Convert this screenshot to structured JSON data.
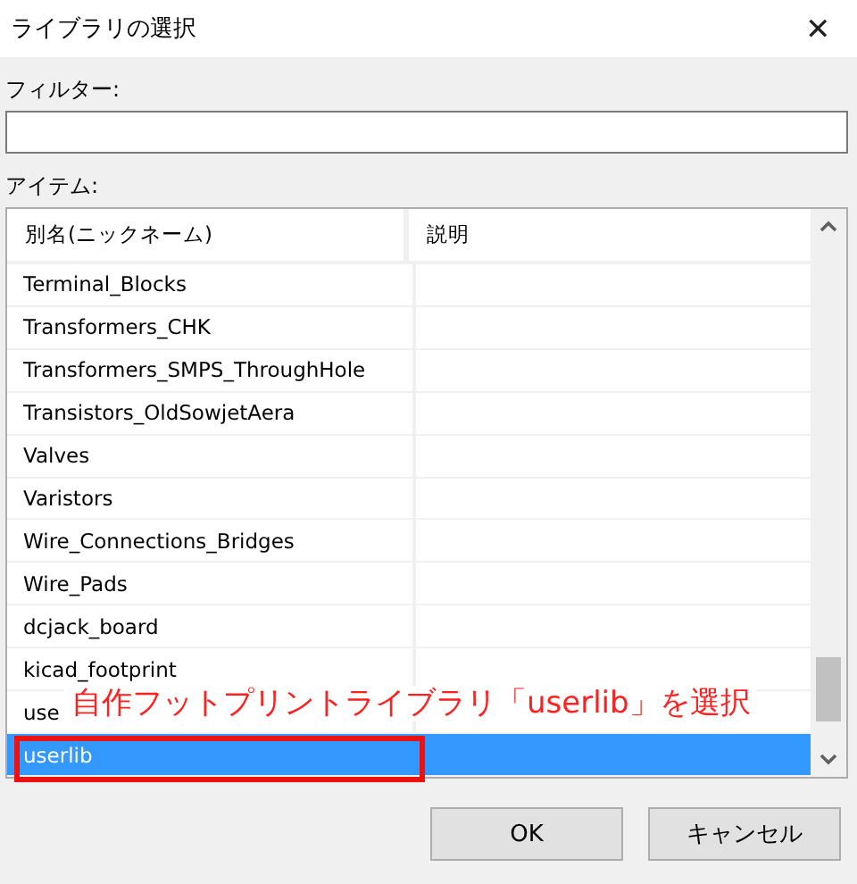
{
  "window": {
    "title": "ライブラリの選択",
    "close": "✕"
  },
  "filter": {
    "label": "フィルター:"
  },
  "items": {
    "label": "アイテム:",
    "columns": [
      "別名(ニックネーム)",
      "説明"
    ],
    "rows": [
      {
        "name": "Terminal_Blocks",
        "selected": false
      },
      {
        "name": "Transformers_CHK",
        "selected": false
      },
      {
        "name": "Transformers_SMPS_ThroughHole",
        "selected": false
      },
      {
        "name": "Transistors_OldSowjetAera",
        "selected": false
      },
      {
        "name": "Valves",
        "selected": false
      },
      {
        "name": "Varistors",
        "selected": false
      },
      {
        "name": "Wire_Connections_Bridges",
        "selected": false
      },
      {
        "name": "Wire_Pads",
        "selected": false
      },
      {
        "name": "dcjack_board",
        "selected": false
      },
      {
        "name": "kicad_footprint",
        "selected": false
      },
      {
        "name": "use",
        "selected": false
      },
      {
        "name": "userlib",
        "selected": true
      }
    ]
  },
  "annotation": {
    "text": "自作フットプリントライブラリ「userlib」を選択"
  },
  "buttons": [
    "OK",
    "キャンセル"
  ]
}
